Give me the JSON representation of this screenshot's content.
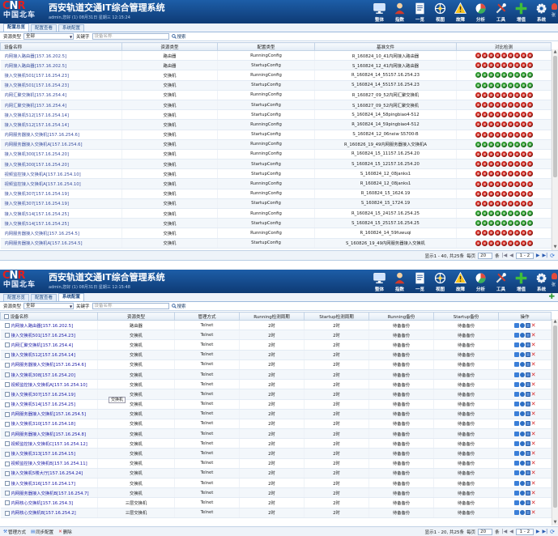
{
  "header": {
    "logo_cnr": "CNR",
    "logo_cn": "中国北车",
    "title": "西安轨道交通IT综合管理系统",
    "userinfo": "admin,您好 (1) 08月31日 星期三 12:15:24",
    "userinfo2": "admin,您好 (1) 08月31日 星期三 12:15:48",
    "nav": [
      {
        "label": "整体",
        "icon": "monitor-icon"
      },
      {
        "label": "指数",
        "icon": "person-icon"
      },
      {
        "label": "一览",
        "icon": "document-icon"
      },
      {
        "label": "视图",
        "icon": "network-icon"
      },
      {
        "label": "故障",
        "icon": "warning-icon"
      },
      {
        "label": "分析",
        "icon": "chart-icon"
      },
      {
        "label": "工具",
        "icon": "tools-icon"
      },
      {
        "label": "增值",
        "icon": "plus-icon"
      },
      {
        "label": "系统",
        "icon": "gear-icon"
      }
    ],
    "corner": "张"
  },
  "tabs": [
    "配置总览",
    "配置查看",
    "系统配置"
  ],
  "filter": {
    "type_label": "资源类型",
    "type_value": "全部",
    "keyword_label": "关键字",
    "keyword_placeholder": "设备名称",
    "search": "搜索"
  },
  "panel1": {
    "columns": [
      "设备名称",
      "资源类型",
      "配置类型",
      "基准文件",
      "对比检测"
    ],
    "rows": [
      [
        "内网接入路由器[157.16.202.5]",
        "路由器",
        "RunningConfig",
        "R_160824_10_41内网接入路由器",
        "rrrrrrrrr"
      ],
      [
        "内网接入路由器[157.16.202.5]",
        "路由器",
        "StartupConfig",
        "S_160824_12_41内网接入路由器",
        "rrrrrrrrr"
      ],
      [
        "接入交换机501[157.16.254.23]",
        "交换机",
        "RunningConfig",
        "R_160824_14_55157.16.254.23",
        "ggggggggg"
      ],
      [
        "接入交换机501[157.16.254.23]",
        "交换机",
        "StartupConfig",
        "S_160824_14_55157.16.254.23",
        "ggggggggg"
      ],
      [
        "内网汇聚交换机[157.16.254.4]",
        "交换机",
        "RunningConfig",
        "R_160827_09_52内网汇聚交换机",
        "rrrrrrrrr"
      ],
      [
        "内网汇聚交换机[157.16.254.4]",
        "交换机",
        "StartupConfig",
        "S_160827_09_52内网汇聚交换机",
        "rrrrrrrrr"
      ],
      [
        "接入交换机512[157.16.254.14]",
        "交换机",
        "StartupConfig",
        "S_160824_14_58pingbiao4-512",
        "rrrrrrrrr"
      ],
      [
        "接入交换机512[157.16.254.14]",
        "交换机",
        "RunningConfig",
        "R_160824_14_59pingbiao4-512",
        "rrrrrrrrr"
      ],
      [
        "内网服务器接入交换机[157.16.254.6]",
        "交换机",
        "StartupConfig",
        "S_160824_12_06neiw S5700-B",
        "rrrrrrrrr"
      ],
      [
        "内网服务器接入交换机A[157.16.254.6]",
        "交换机",
        "RunningConfig",
        "R_160826_19_49内网服务器接入交换机A",
        "ggggggggg"
      ],
      [
        "接入交换机300[157.16.254.20]",
        "交换机",
        "RunningConfig",
        "R_160824_15_11157.16.254.20",
        "rrrrrrrrr"
      ],
      [
        "接入交换机300[157.16.254.20]",
        "交换机",
        "StartupConfig",
        "S_160824_15_12157.16.254.20",
        "rrrrrrrrr"
      ],
      [
        "视频监控接入交换机A[157.16.254.10]",
        "交换机",
        "StartupConfig",
        "S_160824_12_08janks1",
        "rrrrrrrrr"
      ],
      [
        "视频监控接入交换机A[157.16.254.10]",
        "交换机",
        "RunningConfig",
        "R_160824_12_08janks1",
        "rrrrrrrrr"
      ],
      [
        "接入交换机307[157.16.254.19]",
        "交换机",
        "RunningConfig",
        "R_160824_15_1624.19",
        "rrrrrrrrr"
      ],
      [
        "接入交换机307[157.16.254.19]",
        "交换机",
        "StartupConfig",
        "S_160824_15_1724.19",
        "rrrrrrrrr"
      ],
      [
        "接入交换机514[157.16.254.25]",
        "交换机",
        "RunningConfig",
        "R_160824_15_24157.16.254.25",
        "ggggggggg"
      ],
      [
        "接入交换机514[157.16.254.25]",
        "交换机",
        "StartupConfig",
        "S_160824_15_25157.16.254.25",
        "ggggggggg"
      ],
      [
        "内网服务器接入交换机[157.16.254.5]",
        "交换机",
        "RunningConfig",
        "R_160824_14_59fuwuqi",
        "rrrrrrrrr"
      ],
      [
        "内网服务器接入交换机A[157.16.254.5]",
        "交换机",
        "StartupConfig",
        "S_160826_19_49内网服务器接入交换机",
        "rrrrrrrrr"
      ]
    ],
    "pager": {
      "summary": "显示1 - 40, 共25条",
      "per_page_label": "每页",
      "per_page": "20",
      "per_page_suffix": "条",
      "page": "1 - 2"
    }
  },
  "panel2": {
    "columns": [
      "设备名称",
      "资源类型",
      "管理方式",
      "Running检测周期",
      "Startup检测周期",
      "Running备份",
      "Startup备份",
      "操作"
    ],
    "rows": [
      [
        "内网接入路由器[157.16.202.5]",
        "路由器",
        "Telnet",
        "2时",
        "2时",
        "待备备份",
        "待备备份"
      ],
      [
        "接入交换机501[157.16.254.23]",
        "交换机",
        "Telnet",
        "2时",
        "2时",
        "待备备份",
        "待备备份"
      ],
      [
        "内网汇聚交换机[157.16.254.4]",
        "交换机",
        "Telnet",
        "2时",
        "2时",
        "待备备份",
        "待备备份"
      ],
      [
        "接入交换机512[157.16.254.14]",
        "交换机",
        "Telnet",
        "2时",
        "2时",
        "待备备份",
        "待备备份"
      ],
      [
        "内网服务器接入交换机[157.16.254.6]",
        "交换机",
        "Telnet",
        "2时",
        "2时",
        "待备备份",
        "待备备份"
      ],
      [
        "接入交换机308[157.16.254.20]",
        "交换机",
        "Telnet",
        "2时",
        "2时",
        "待备备份",
        "待备备份"
      ],
      [
        "视频监控接入交换机A[157.16.254.10]",
        "交换机",
        "Telnet",
        "2时",
        "2时",
        "待备备份",
        "待备备份"
      ],
      [
        "接入交换机307[157.16.254.19]",
        "交换机",
        "Telnet",
        "2时",
        "2时",
        "待备备份",
        "待备备份"
      ],
      [
        "接入交换机514[157.16.254.25]",
        "交换机",
        "Telnet",
        "2时",
        "2时",
        "待备备份",
        "待备备份"
      ],
      [
        "内网服务器接入交换机[157.16.254.5]",
        "交换机",
        "Telnet",
        "2时",
        "2时",
        "待备备份",
        "待备备份"
      ],
      [
        "接入交换机310[157.16.254.18]",
        "交换机",
        "Telnet",
        "2时",
        "2时",
        "待备备份",
        "待备备份"
      ],
      [
        "内网服务器接入交换机[157.16.254.8]",
        "交换机",
        "Telnet",
        "2时",
        "2时",
        "待备备份",
        "待备备份"
      ],
      [
        "视频监控接入交换机C[157.16.254.12]",
        "交换机",
        "Telnet",
        "2时",
        "2时",
        "待备备份",
        "待备备份"
      ],
      [
        "接入交换机313[157.16.254.15]",
        "交换机",
        "Telnet",
        "2时",
        "2时",
        "待备备份",
        "待备备份"
      ],
      [
        "视频监控接入交换机B[157.16.254.11]",
        "交换机",
        "Telnet",
        "2时",
        "2时",
        "待备备份",
        "待备备份"
      ],
      [
        "接入交换机5楼大厅[157.16.254.24]",
        "交换机",
        "Telnet",
        "2时",
        "2时",
        "待备备份",
        "待备备份"
      ],
      [
        "接入交换机316[157.16.254.17]",
        "交换机",
        "Telnet",
        "2时",
        "2时",
        "待备备份",
        "待备备份"
      ],
      [
        "内网服务器接入交换机B[157.16.254.7]",
        "交换机",
        "Telnet",
        "2时",
        "2时",
        "待备备份",
        "待备备份"
      ],
      [
        "内网核心交换机[157.16.254.3]",
        "三层交换机",
        "Telnet",
        "2时",
        "2时",
        "待备备份",
        "待备备份"
      ],
      [
        "内网核心交换机B[157.16.254.2]",
        "三层交换机",
        "Telnet",
        "2时",
        "2时",
        "待备备份",
        "待备备份"
      ]
    ],
    "tooltip": "交换机",
    "toolbar": {
      "manage": "管理方式",
      "sync": "同步配置",
      "delete": "删除"
    },
    "pager": {
      "summary": "显示1 - 20, 共25条",
      "per_page_label": "每页",
      "per_page": "20",
      "per_page_suffix": "条",
      "page": "1 - 2"
    }
  },
  "colors": {
    "header_top": "#1d5ea8",
    "header_bottom": "#0e3a74",
    "dot_red": "#cf2a22",
    "dot_green": "#2d9b2e",
    "link": "#1a1aa6"
  }
}
